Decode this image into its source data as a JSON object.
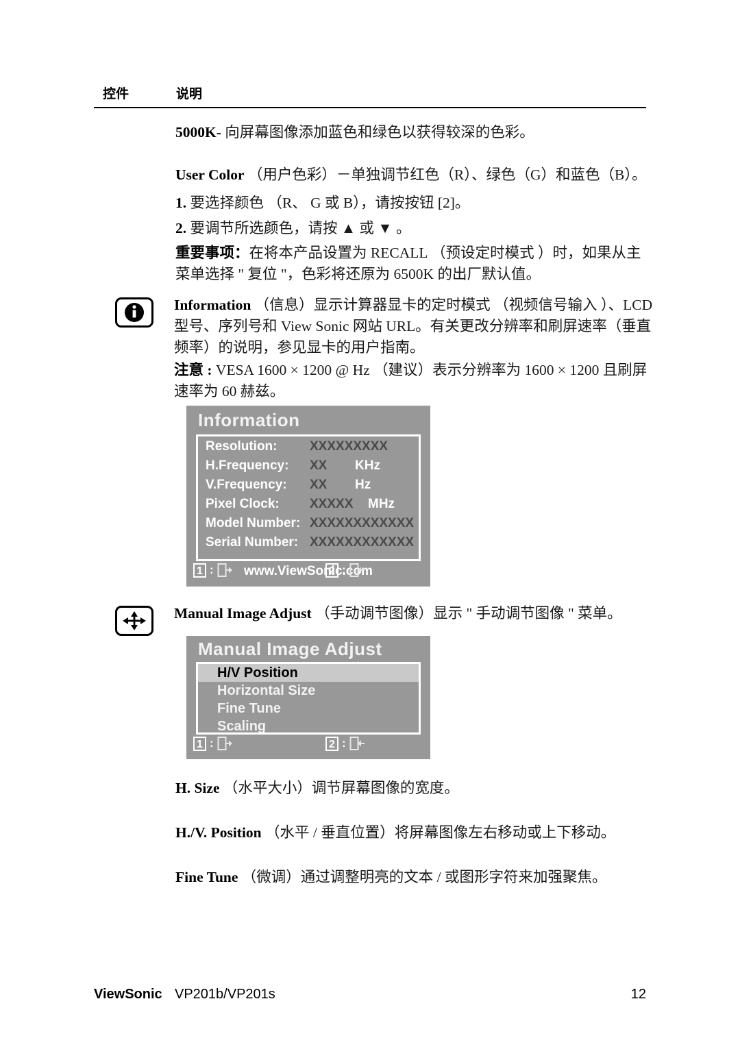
{
  "header": {
    "column_control": "控件",
    "column_description": "说明"
  },
  "body": {
    "p_5000k_bold": "5000K-",
    "p_5000k_text": " 向屏幕图像添加蓝色和绿色以获得较深的色彩。",
    "p_user_bold": "User Color",
    "p_user_text": " （用户色彩）－单独调节红色（R）、绿色（G）和蓝色（B）。",
    "p_step1_bold": "1.",
    "p_step1_text": " 要选择颜色 （R、 G 或 B），请按按钮 [2]。",
    "p_step2_bold": "2.",
    "p_step2_text": " 要调节所选颜色，请按 ▲ 或 ▼ 。",
    "p_important_bold": "重要事项：",
    "p_important_text": "在将本产品设置为 RECALL （预设定时模式 ）时，如果从主菜单选择 \" 复位 \"，色彩将还原为 6500K 的出厂默认值。",
    "p_info_bold": "Information",
    "p_info_text": " （信息）显示计算器显卡的定时模式 （视频信号输入 ）、LCD 型号、序列号和 View Sonic 网站 URL。有关更改分辨率和刷屏速率（垂直频率）的说明，参见显卡的用户指南。",
    "p_note_bold": "注意 :",
    "p_note_text": " VESA 1600 × 1200 @ Hz （建议）表示分辨率为 1600 × 1200 且刷屏速率为 60 赫兹。",
    "p_manual_bold": "Manual Image Adjust",
    "p_manual_text": " （手动调节图像）显示 \" 手动调节图像 \" 菜单。",
    "p_hsize_bold": "H. Size",
    "p_hsize_text": " （水平大小）调节屏幕图像的宽度。",
    "p_hvpos_bold": "H./V. Position",
    "p_hvpos_text": " （水平 / 垂直位置）将屏幕图像左右移动或上下移动。",
    "p_finetune_bold": "Fine Tune",
    "p_finetune_text": " （微调）通过调整明亮的文本 / 或图形字符来加强聚焦。"
  },
  "icons": {
    "information": "information-icon",
    "manual_image_adjust": "four-way-arrow-icon"
  },
  "osd_information": {
    "title": "Information",
    "rows": [
      {
        "label": "Resolution:",
        "value": "XXXXXXXXX",
        "unit": ""
      },
      {
        "label": "H.Frequency:",
        "value": "XX",
        "unit": "KHz"
      },
      {
        "label": "V.Frequency:",
        "value": "XX",
        "unit": "Hz"
      },
      {
        "label": "Pixel Clock:",
        "value": "XXXXX",
        "unit": "MHz"
      },
      {
        "label": "Model Number:",
        "value": "XXXXXXXXXXXX",
        "unit": ""
      },
      {
        "label": "Serial Number:",
        "value": "XXXXXXXXXXXX",
        "unit": ""
      }
    ],
    "url": "www.ViewSonic.com",
    "key_exit_num": "1",
    "key_exit_sep": ":",
    "key_enter_num": "2",
    "key_enter_sep": ":"
  },
  "osd_manual": {
    "title": "Manual Image Adjust",
    "items": [
      {
        "label": "H/V Position",
        "selected": true
      },
      {
        "label": "Horizontal Size",
        "selected": false
      },
      {
        "label": "Fine Tune",
        "selected": false
      },
      {
        "label": "Scaling",
        "selected": false
      }
    ],
    "key_exit_num": "1",
    "key_exit_sep": ":",
    "key_enter_num": "2",
    "key_enter_sep": ":"
  },
  "footer": {
    "brand": "ViewSonic",
    "model": "VP201b/VP201s",
    "page": "12"
  },
  "colors": {
    "osd_background": "#989898",
    "osd_highlight": "#c9c9c9",
    "osd_value_text": "#4a4a4a",
    "page_background": "#ffffff"
  }
}
